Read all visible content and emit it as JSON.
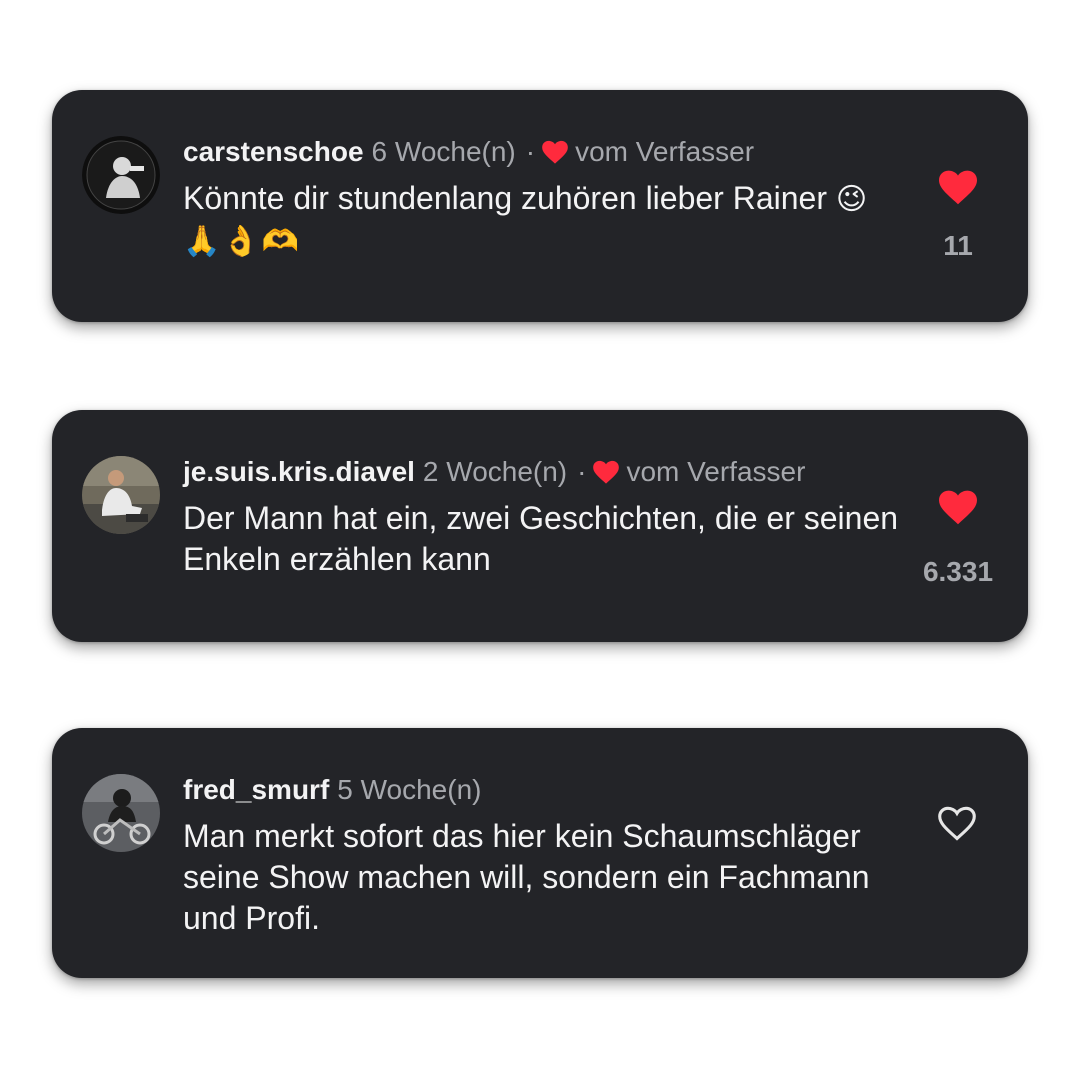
{
  "accent_like_color": "#ff2a3d",
  "card_background": "#232428",
  "comments": [
    {
      "username": "carstenschoe",
      "time": "6 Woche(n)",
      "separator": "·",
      "author_like_label": "vom Verfasser",
      "text": "Könnte dir stundenlang zuhören lieber Rainer ",
      "emoji": "😉🙏👌🫶",
      "liked": true,
      "like_count": "11",
      "avatar_icon": "avatar-photo"
    },
    {
      "username": "je.suis.kris.diavel",
      "time": "2 Woche(n)",
      "separator": "·",
      "author_like_label": "vom Verfasser",
      "text": "Der Mann hat ein, zwei Geschichten, die er seinen Enkeln erzählen kann",
      "emoji": "",
      "liked": true,
      "like_count": "6.331",
      "avatar_icon": "avatar-photo"
    },
    {
      "username": "fred_smurf",
      "time": "5 Woche(n)",
      "text": "Man merkt sofort das hier kein Schaumschläger seine Show machen will, sondern ein Fachmann und Profi.",
      "liked": false,
      "avatar_icon": "avatar-photo"
    }
  ]
}
